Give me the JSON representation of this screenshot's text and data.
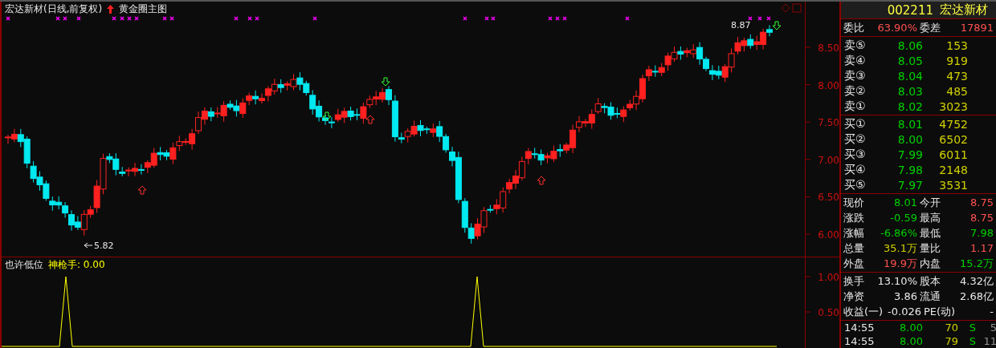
{
  "chart": {
    "title": "宏达新材(日线,前复权)",
    "formula": "黄金圈主图",
    "price_ticks": [
      "8.50",
      "8.00",
      "7.50",
      "7.00",
      "6.50",
      "6.00"
    ],
    "high_label": "8.87",
    "low_label": "5.82"
  },
  "indicator": {
    "name": "也许低位",
    "series_label": "神枪手: 0.00",
    "ticks": [
      "1.00",
      "0.50"
    ]
  },
  "quote": {
    "code": "002211",
    "name": "宏达新材",
    "summary": [
      {
        "label": "委比",
        "value": "63.90%",
        "color": "#ff5050"
      },
      {
        "label": "委差",
        "value": "17891",
        "color": "#ff5050"
      }
    ],
    "asks": [
      {
        "label": "卖⑤",
        "price": "8.06",
        "volume": "153"
      },
      {
        "label": "卖④",
        "price": "8.05",
        "volume": "919"
      },
      {
        "label": "卖③",
        "price": "8.04",
        "volume": "473"
      },
      {
        "label": "卖②",
        "price": "8.03",
        "volume": "485"
      },
      {
        "label": "卖①",
        "price": "8.02",
        "volume": "3023"
      }
    ],
    "bids": [
      {
        "label": "买①",
        "price": "8.01",
        "volume": "4752"
      },
      {
        "label": "买②",
        "price": "8.00",
        "volume": "6502"
      },
      {
        "label": "买③",
        "price": "7.99",
        "volume": "6011"
      },
      {
        "label": "买④",
        "price": "7.98",
        "volume": "2148"
      },
      {
        "label": "买⑤",
        "price": "7.97",
        "volume": "3531"
      }
    ],
    "stats": [
      {
        "label": "现价",
        "value": "8.01",
        "color": "#00d000"
      },
      {
        "label": "今开",
        "value": "8.75",
        "color": "#ff5050"
      },
      {
        "label": "涨跌",
        "value": "-0.59",
        "color": "#00d000"
      },
      {
        "label": "最高",
        "value": "8.75",
        "color": "#ff5050"
      },
      {
        "label": "涨幅",
        "value": "-6.86%",
        "color": "#00d000"
      },
      {
        "label": "最低",
        "value": "7.98",
        "color": "#00d000"
      },
      {
        "label": "总量",
        "value": "35.1万",
        "color": "#d0d000"
      },
      {
        "label": "量比",
        "value": "1.17",
        "color": "#ff5050"
      },
      {
        "label": "外盘",
        "value": "19.9万",
        "color": "#ff5050"
      },
      {
        "label": "内盘",
        "value": "15.2万",
        "color": "#00d000"
      }
    ],
    "finance": [
      {
        "label": "换手",
        "value": "13.10%"
      },
      {
        "label": "股本",
        "value": "4.32亿"
      },
      {
        "label": "净资",
        "value": "3.86"
      },
      {
        "label": "流通",
        "value": "2.68亿"
      },
      {
        "label": "收益(一)",
        "value": "-0.026"
      },
      {
        "label": "PE(动)",
        "value": "-"
      }
    ],
    "trades": [
      {
        "time": "14:55",
        "price": "8.00",
        "volume": "70",
        "side": "S",
        "count": "5"
      },
      {
        "time": "14:55",
        "price": "8.00",
        "volume": "79",
        "side": "S",
        "count": "11"
      }
    ]
  }
}
